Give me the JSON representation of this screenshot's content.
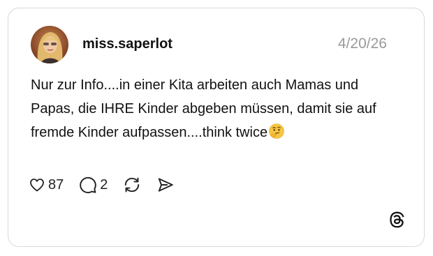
{
  "post": {
    "username": "miss.saperlot",
    "date": "4/20/26",
    "text": "Nur zur Info....in einer Kita arbeiten auch Mamas und Papas, die IHRE Kinder abgeben müssen, damit sie auf fremde Kinder aufpassen....think twice",
    "text_emoji": "thinking-face-emoji"
  },
  "actions": {
    "likes": "87",
    "replies": "2",
    "like_icon": "heart-icon",
    "reply_icon": "comment-bubble-icon",
    "repost_icon": "repost-icon",
    "share_icon": "share-icon"
  },
  "branding": {
    "logo": "threads-logo-icon"
  },
  "colors": {
    "text": "#111111",
    "muted": "#9a9a9a",
    "border": "#d9d9d9"
  }
}
